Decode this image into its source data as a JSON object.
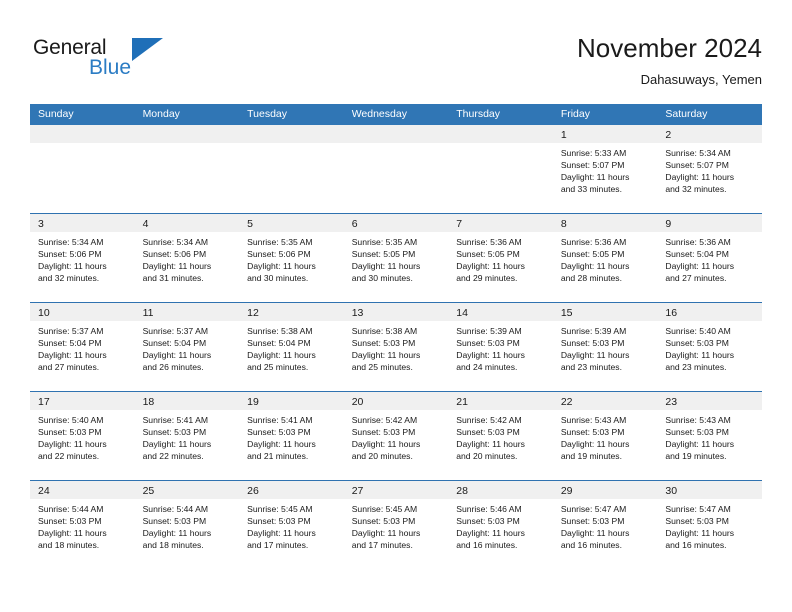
{
  "brand": {
    "name_part1": "General",
    "name_part2": "Blue",
    "flag_icon": "blue-triangle-flag-icon"
  },
  "header": {
    "title": "November 2024",
    "subtitle": "Dahasuways, Yemen"
  },
  "colors": {
    "header_blue": "#3076b5",
    "row_divider_blue": "#2f72b0",
    "day_band_gray": "#f0f0f0",
    "brand_blue": "#2b7cc4",
    "text": "#1a1a1a"
  },
  "weekdays": [
    "Sunday",
    "Monday",
    "Tuesday",
    "Wednesday",
    "Thursday",
    "Friday",
    "Saturday"
  ],
  "weeks": [
    [
      {
        "day": "",
        "lines": []
      },
      {
        "day": "",
        "lines": []
      },
      {
        "day": "",
        "lines": []
      },
      {
        "day": "",
        "lines": []
      },
      {
        "day": "",
        "lines": []
      },
      {
        "day": "1",
        "lines": [
          "Sunrise: 5:33 AM",
          "Sunset: 5:07 PM",
          "Daylight: 11 hours",
          "and 33 minutes."
        ]
      },
      {
        "day": "2",
        "lines": [
          "Sunrise: 5:34 AM",
          "Sunset: 5:07 PM",
          "Daylight: 11 hours",
          "and 32 minutes."
        ]
      }
    ],
    [
      {
        "day": "3",
        "lines": [
          "Sunrise: 5:34 AM",
          "Sunset: 5:06 PM",
          "Daylight: 11 hours",
          "and 32 minutes."
        ]
      },
      {
        "day": "4",
        "lines": [
          "Sunrise: 5:34 AM",
          "Sunset: 5:06 PM",
          "Daylight: 11 hours",
          "and 31 minutes."
        ]
      },
      {
        "day": "5",
        "lines": [
          "Sunrise: 5:35 AM",
          "Sunset: 5:06 PM",
          "Daylight: 11 hours",
          "and 30 minutes."
        ]
      },
      {
        "day": "6",
        "lines": [
          "Sunrise: 5:35 AM",
          "Sunset: 5:05 PM",
          "Daylight: 11 hours",
          "and 30 minutes."
        ]
      },
      {
        "day": "7",
        "lines": [
          "Sunrise: 5:36 AM",
          "Sunset: 5:05 PM",
          "Daylight: 11 hours",
          "and 29 minutes."
        ]
      },
      {
        "day": "8",
        "lines": [
          "Sunrise: 5:36 AM",
          "Sunset: 5:05 PM",
          "Daylight: 11 hours",
          "and 28 minutes."
        ]
      },
      {
        "day": "9",
        "lines": [
          "Sunrise: 5:36 AM",
          "Sunset: 5:04 PM",
          "Daylight: 11 hours",
          "and 27 minutes."
        ]
      }
    ],
    [
      {
        "day": "10",
        "lines": [
          "Sunrise: 5:37 AM",
          "Sunset: 5:04 PM",
          "Daylight: 11 hours",
          "and 27 minutes."
        ]
      },
      {
        "day": "11",
        "lines": [
          "Sunrise: 5:37 AM",
          "Sunset: 5:04 PM",
          "Daylight: 11 hours",
          "and 26 minutes."
        ]
      },
      {
        "day": "12",
        "lines": [
          "Sunrise: 5:38 AM",
          "Sunset: 5:04 PM",
          "Daylight: 11 hours",
          "and 25 minutes."
        ]
      },
      {
        "day": "13",
        "lines": [
          "Sunrise: 5:38 AM",
          "Sunset: 5:03 PM",
          "Daylight: 11 hours",
          "and 25 minutes."
        ]
      },
      {
        "day": "14",
        "lines": [
          "Sunrise: 5:39 AM",
          "Sunset: 5:03 PM",
          "Daylight: 11 hours",
          "and 24 minutes."
        ]
      },
      {
        "day": "15",
        "lines": [
          "Sunrise: 5:39 AM",
          "Sunset: 5:03 PM",
          "Daylight: 11 hours",
          "and 23 minutes."
        ]
      },
      {
        "day": "16",
        "lines": [
          "Sunrise: 5:40 AM",
          "Sunset: 5:03 PM",
          "Daylight: 11 hours",
          "and 23 minutes."
        ]
      }
    ],
    [
      {
        "day": "17",
        "lines": [
          "Sunrise: 5:40 AM",
          "Sunset: 5:03 PM",
          "Daylight: 11 hours",
          "and 22 minutes."
        ]
      },
      {
        "day": "18",
        "lines": [
          "Sunrise: 5:41 AM",
          "Sunset: 5:03 PM",
          "Daylight: 11 hours",
          "and 22 minutes."
        ]
      },
      {
        "day": "19",
        "lines": [
          "Sunrise: 5:41 AM",
          "Sunset: 5:03 PM",
          "Daylight: 11 hours",
          "and 21 minutes."
        ]
      },
      {
        "day": "20",
        "lines": [
          "Sunrise: 5:42 AM",
          "Sunset: 5:03 PM",
          "Daylight: 11 hours",
          "and 20 minutes."
        ]
      },
      {
        "day": "21",
        "lines": [
          "Sunrise: 5:42 AM",
          "Sunset: 5:03 PM",
          "Daylight: 11 hours",
          "and 20 minutes."
        ]
      },
      {
        "day": "22",
        "lines": [
          "Sunrise: 5:43 AM",
          "Sunset: 5:03 PM",
          "Daylight: 11 hours",
          "and 19 minutes."
        ]
      },
      {
        "day": "23",
        "lines": [
          "Sunrise: 5:43 AM",
          "Sunset: 5:03 PM",
          "Daylight: 11 hours",
          "and 19 minutes."
        ]
      }
    ],
    [
      {
        "day": "24",
        "lines": [
          "Sunrise: 5:44 AM",
          "Sunset: 5:03 PM",
          "Daylight: 11 hours",
          "and 18 minutes."
        ]
      },
      {
        "day": "25",
        "lines": [
          "Sunrise: 5:44 AM",
          "Sunset: 5:03 PM",
          "Daylight: 11 hours",
          "and 18 minutes."
        ]
      },
      {
        "day": "26",
        "lines": [
          "Sunrise: 5:45 AM",
          "Sunset: 5:03 PM",
          "Daylight: 11 hours",
          "and 17 minutes."
        ]
      },
      {
        "day": "27",
        "lines": [
          "Sunrise: 5:45 AM",
          "Sunset: 5:03 PM",
          "Daylight: 11 hours",
          "and 17 minutes."
        ]
      },
      {
        "day": "28",
        "lines": [
          "Sunrise: 5:46 AM",
          "Sunset: 5:03 PM",
          "Daylight: 11 hours",
          "and 16 minutes."
        ]
      },
      {
        "day": "29",
        "lines": [
          "Sunrise: 5:47 AM",
          "Sunset: 5:03 PM",
          "Daylight: 11 hours",
          "and 16 minutes."
        ]
      },
      {
        "day": "30",
        "lines": [
          "Sunrise: 5:47 AM",
          "Sunset: 5:03 PM",
          "Daylight: 11 hours",
          "and 16 minutes."
        ]
      }
    ]
  ]
}
